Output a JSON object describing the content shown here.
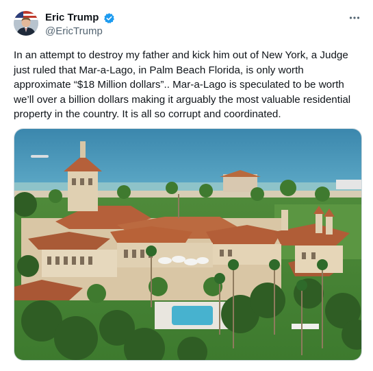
{
  "author": {
    "display_name": "Eric Trump",
    "handle": "@EricTrump",
    "verified": true,
    "avatar_icon": "user-avatar"
  },
  "more_icon": "more-options-icon",
  "tweet": {
    "text": "In an attempt to destroy my father and kick him out of New York, a Judge just ruled that Mar-a-Lago, in Palm Beach Florida, is only worth approximate “$18 Million dollars”.. Mar-a-Lago is speculated to be worth we’ll over a billion dollars making it arguably the most valuable residential property in the country. It is all so corrupt and coordinated."
  },
  "media": {
    "kind": "photo"
  },
  "colors": {
    "text": "#0f1419",
    "secondary": "#536471",
    "verified_blue": "#1d9bf0",
    "border": "#cfd9de"
  }
}
